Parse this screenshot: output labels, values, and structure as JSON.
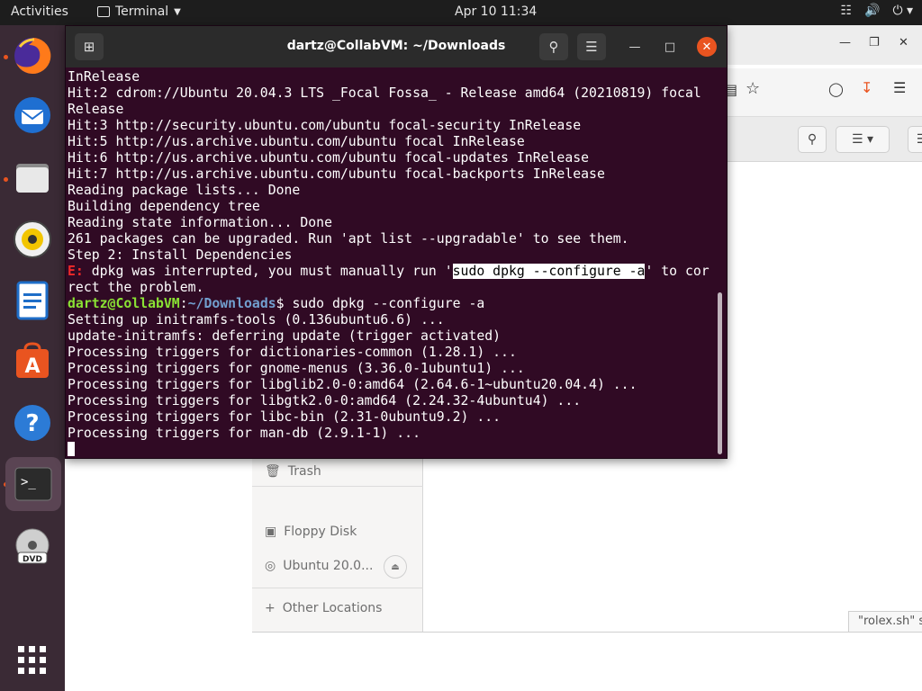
{
  "topbar": {
    "activities": "Activities",
    "app_name": "Terminal",
    "clock": "Apr 10  11:34"
  },
  "dock": {
    "items": [
      "firefox-icon",
      "thunderbird-icon",
      "files-icon",
      "rhythmbox-icon",
      "libreoffice-writer-icon",
      "software-center-icon",
      "help-icon",
      "terminal-icon",
      "dvd-icon",
      "app-grid-icon"
    ]
  },
  "terminal": {
    "title": "dartz@CollabVM: ~/Downloads",
    "lines": [
      [
        {
          "t": "InRelease"
        }
      ],
      [
        {
          "t": "Hit:2 cdrom://Ubuntu 20.04.3 LTS _Focal Fossa_ - Release amd64 (20210819) focal"
        }
      ],
      [
        {
          "t": "Release"
        }
      ],
      [
        {
          "t": "Hit:3 http://security.ubuntu.com/ubuntu focal-security InRelease"
        }
      ],
      [
        {
          "t": "Hit:5 http://us.archive.ubuntu.com/ubuntu focal InRelease"
        }
      ],
      [
        {
          "t": "Hit:6 http://us.archive.ubuntu.com/ubuntu focal-updates InRelease"
        }
      ],
      [
        {
          "t": "Hit:7 http://us.archive.ubuntu.com/ubuntu focal-backports InRelease"
        }
      ],
      [
        {
          "t": "Reading package lists... Done"
        }
      ],
      [
        {
          "t": "Building dependency tree"
        }
      ],
      [
        {
          "t": "Reading state information... Done"
        }
      ],
      [
        {
          "t": "261 packages can be upgraded. Run 'apt list --upgradable' to see them."
        }
      ],
      [
        {
          "t": "Step 2: Install Dependencies"
        }
      ],
      [
        {
          "t": "E:",
          "c": "c-red"
        },
        {
          "t": " dpkg was interrupted, you must manually run '"
        },
        {
          "t": "sudo dpkg --configure -a",
          "c": "hl"
        },
        {
          "t": "' to cor"
        }
      ],
      [
        {
          "t": "rect the problem."
        }
      ],
      [
        {
          "t": "dartz@CollabVM",
          "c": "c-green"
        },
        {
          "t": ":"
        },
        {
          "t": "~/Downloads",
          "c": "c-blue"
        },
        {
          "t": "$ sudo dpkg --configure -a"
        }
      ],
      [
        {
          "t": "Setting up initramfs-tools (0.136ubuntu6.6) ..."
        }
      ],
      [
        {
          "t": "update-initramfs: deferring update (trigger activated)"
        }
      ],
      [
        {
          "t": "Processing triggers for dictionaries-common (1.28.1) ..."
        }
      ],
      [
        {
          "t": "Processing triggers for gnome-menus (3.36.0-1ubuntu1) ..."
        }
      ],
      [
        {
          "t": "Processing triggers for libglib2.0-0:amd64 (2.64.6-1~ubuntu20.04.4) ..."
        }
      ],
      [
        {
          "t": "Processing triggers for libgtk2.0-0:amd64 (2.24.32-4ubuntu4) ..."
        }
      ],
      [
        {
          "t": "Processing triggers for libc-bin (2.31-0ubuntu9.2) ..."
        }
      ],
      [
        {
          "t": "Processing triggers for man-db (2.9.1-1) ..."
        }
      ]
    ]
  },
  "files": {
    "sidebar": {
      "trash": "Trash",
      "floppy": "Floppy Disk",
      "ubuntu_drive": "Ubuntu 20.0...",
      "other_locations": "Other Locations"
    },
    "status_tooltip": "\"rolex.sh\" s"
  }
}
